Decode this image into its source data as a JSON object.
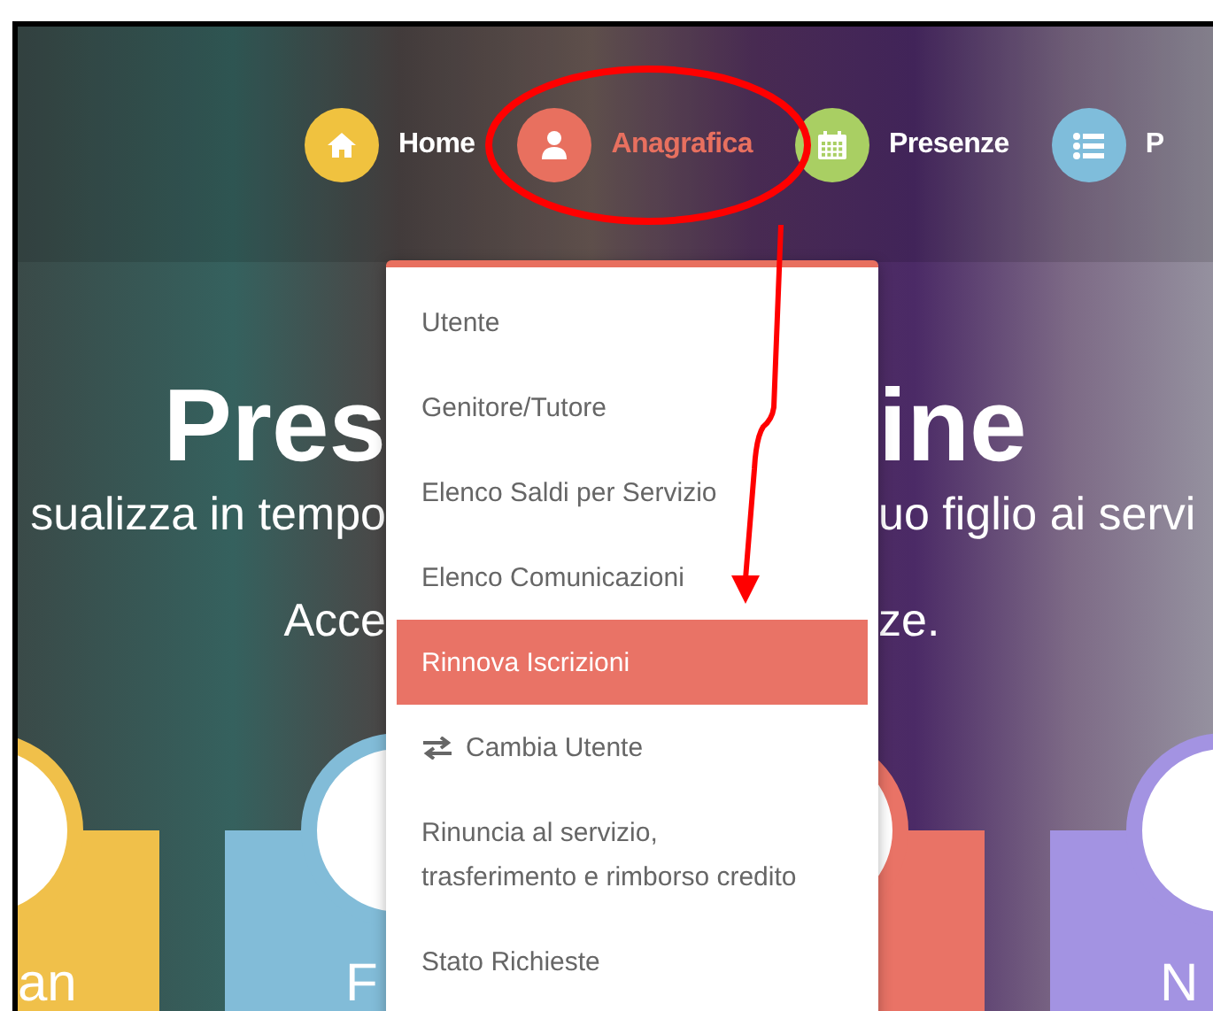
{
  "nav": {
    "items": [
      {
        "label": "Home",
        "selected": false,
        "color": "#f0c23f"
      },
      {
        "label": "Anagrafica",
        "selected": true,
        "color": "#e8705f"
      },
      {
        "label": "Presenze",
        "selected": false,
        "color": "#a9cf63"
      },
      {
        "label": "P",
        "selected": false,
        "color": "#7fbddb"
      }
    ]
  },
  "hero": {
    "title_left": "Pres",
    "title_right": "ine",
    "subtitle_left": "sualizza in tempo",
    "subtitle_right": "uo figlio ai servi",
    "line_left": "Acce",
    "line_right": "ze."
  },
  "dropdown": {
    "items": [
      {
        "label": "Utente",
        "selected": false,
        "kind": "text"
      },
      {
        "label": "Genitore/Tutore",
        "selected": false,
        "kind": "text"
      },
      {
        "label": "Elenco Saldi per Servizio",
        "selected": false,
        "kind": "text"
      },
      {
        "label": "Elenco Comunicazioni",
        "selected": false,
        "kind": "text"
      },
      {
        "label": "Rinnova Iscrizioni",
        "selected": true,
        "kind": "text"
      },
      {
        "label": "Cambia Utente",
        "selected": false,
        "kind": "icon"
      },
      {
        "label": "Rinuncia al servizio,\ntrasferimento e rimborso credito",
        "selected": false,
        "kind": "text"
      },
      {
        "label": "Stato Richieste",
        "selected": false,
        "kind": "text"
      }
    ]
  },
  "cards": [
    {
      "label": "an",
      "color": "#f0c04a"
    },
    {
      "label": "F",
      "color": "#82bcd8"
    },
    {
      "color": "#e97366"
    },
    {
      "label": "N",
      "color": "#a393e2"
    }
  ]
}
